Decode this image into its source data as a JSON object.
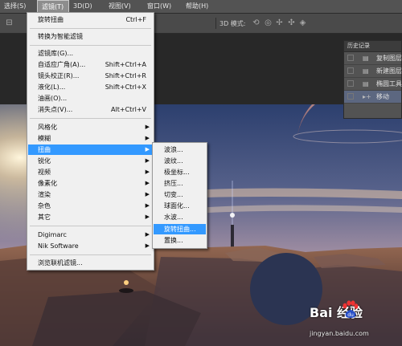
{
  "menubar": {
    "items": [
      {
        "label": "选择(S)"
      },
      {
        "label": "滤镜(T)"
      },
      {
        "label": "3D(D)"
      },
      {
        "label": "视图(V)"
      },
      {
        "label": "窗口(W)"
      },
      {
        "label": "帮助(H)"
      }
    ]
  },
  "options_bar": {
    "mode_label": "3D 模式:"
  },
  "filter_menu": {
    "last_filter": {
      "label": "旋转扭曲",
      "shortcut": "Ctrl+F"
    },
    "smart_filter": {
      "label": "转换为智能滤镜"
    },
    "gallery": {
      "label": "滤镜库(G)..."
    },
    "adaptive_wide": {
      "label": "自适应广角(A)...",
      "shortcut": "Shift+Ctrl+A"
    },
    "lens_correction": {
      "label": "镜头校正(R)...",
      "shortcut": "Shift+Ctrl+R"
    },
    "liquify": {
      "label": "液化(L)...",
      "shortcut": "Shift+Ctrl+X"
    },
    "oil_paint": {
      "label": "油画(O)..."
    },
    "vanishing_point": {
      "label": "消失点(V)...",
      "shortcut": "Alt+Ctrl+V"
    },
    "stylize": {
      "label": "风格化"
    },
    "blur": {
      "label": "模糊"
    },
    "distort": {
      "label": "扭曲"
    },
    "sharpen": {
      "label": "锐化"
    },
    "video": {
      "label": "视频"
    },
    "pixelate": {
      "label": "像素化"
    },
    "render": {
      "label": "渲染"
    },
    "noise": {
      "label": "杂色"
    },
    "other": {
      "label": "其它"
    },
    "digimarc": {
      "label": "Digimarc"
    },
    "nik": {
      "label": "Nik Software"
    },
    "browse_online": {
      "label": "浏览联机滤镜..."
    }
  },
  "distort_submenu": {
    "items": [
      {
        "label": "波浪..."
      },
      {
        "label": "波纹..."
      },
      {
        "label": "极坐标..."
      },
      {
        "label": "挤压..."
      },
      {
        "label": "切变..."
      },
      {
        "label": "球面化..."
      },
      {
        "label": "水波..."
      },
      {
        "label": "旋转扭曲..."
      },
      {
        "label": "置换..."
      }
    ],
    "highlighted_index": 7
  },
  "history_panel": {
    "title": "历史记录",
    "items": [
      {
        "label": "复制图层"
      },
      {
        "label": "新建图层"
      },
      {
        "label": "椭圆工具"
      },
      {
        "label": "移动"
      }
    ],
    "selected_index": 3
  },
  "watermark": {
    "brand": "Bai 经验",
    "url": "jingyan.baidu.com"
  },
  "colors": {
    "menu_highlight": "#3399ff",
    "menu_bg": "#f0f0f0",
    "circle_fill": "#2b3452"
  }
}
